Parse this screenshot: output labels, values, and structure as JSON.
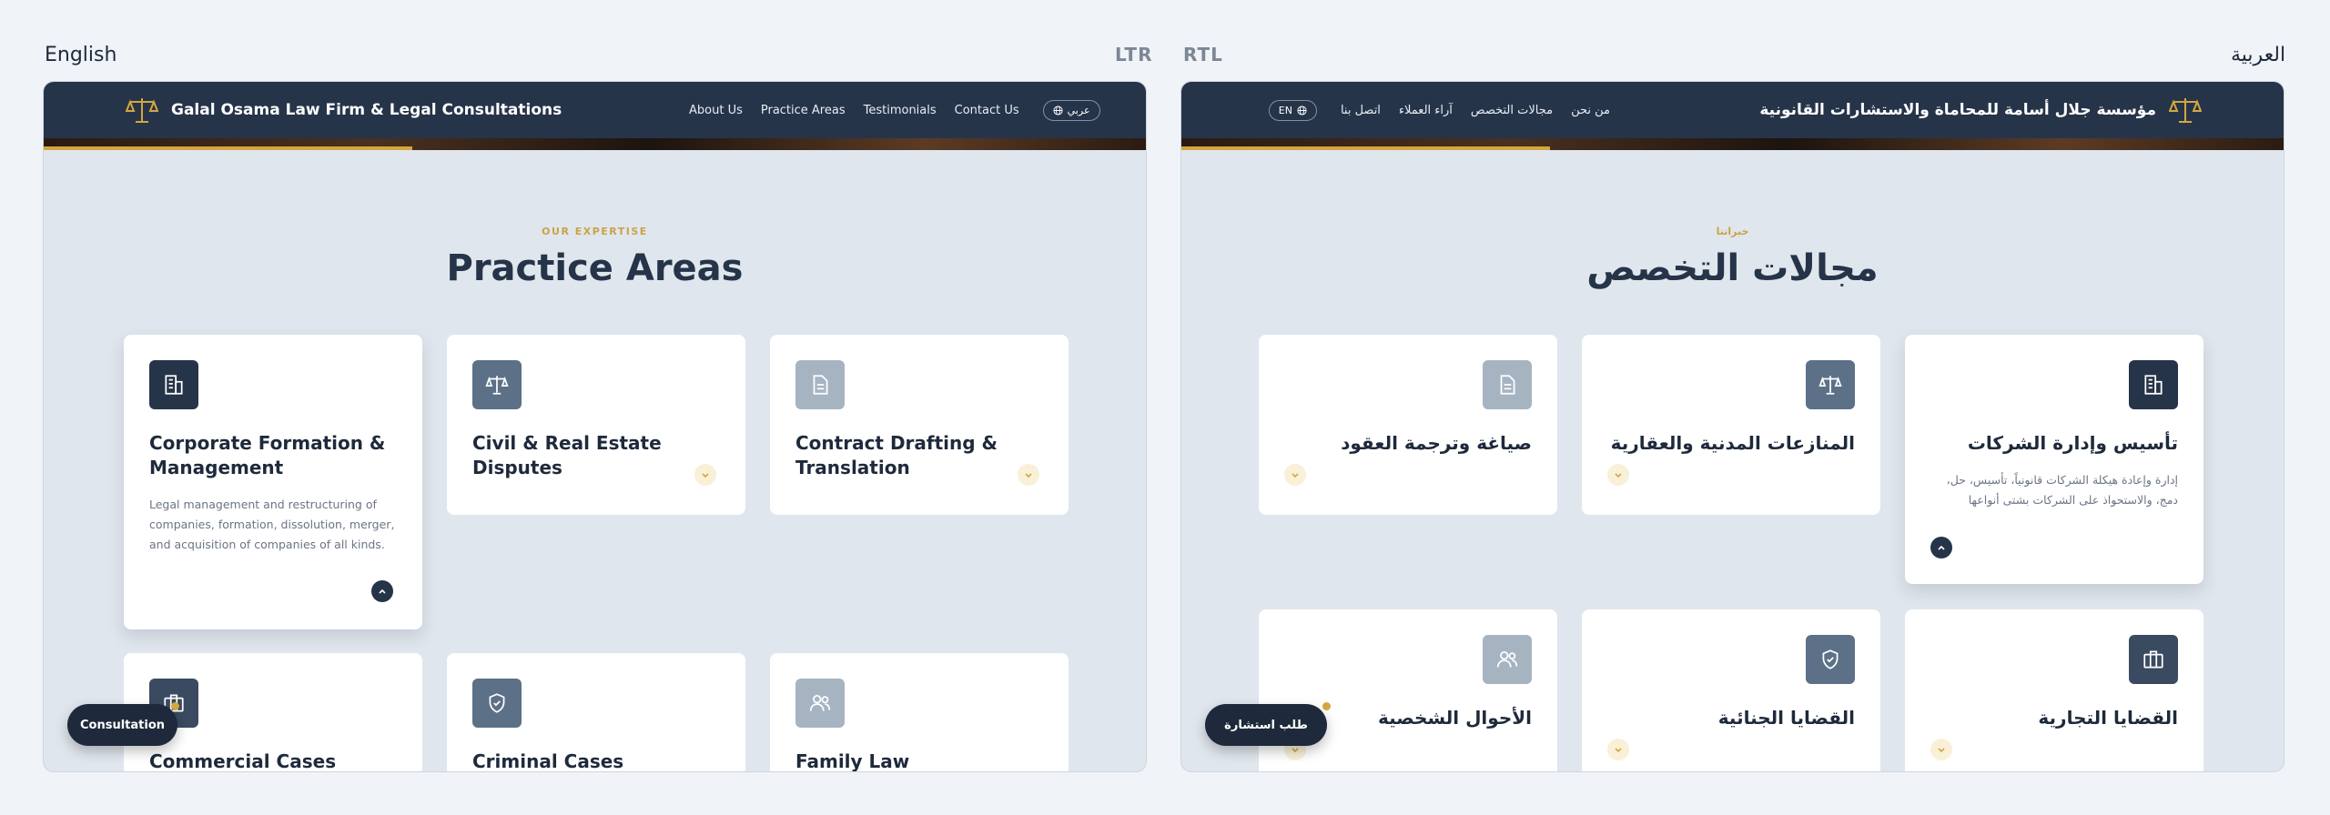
{
  "labels": {
    "left_lang": "English",
    "left_dir": "LTR",
    "right_dir": "RTL",
    "right_lang": "العربية"
  },
  "en": {
    "brand": "Galal Osama Law Firm & Legal Consultations",
    "nav": [
      "About Us",
      "Practice Areas",
      "Testimonials",
      "Contact Us"
    ],
    "lang_toggle": "عربي",
    "eyebrow": "OUR EXPERTISE",
    "title": "Practice Areas",
    "cards": [
      {
        "title": "Corporate Formation & Management",
        "desc": "Legal management and restructuring of companies, formation, dissolution, merger, and acquisition of companies of all kinds.",
        "icon": "building-icon",
        "color": "#263449"
      },
      {
        "title": "Civil & Real Estate Disputes",
        "icon": "scales-icon",
        "color": "#5c7087"
      },
      {
        "title": "Contract Drafting & Translation",
        "icon": "document-icon",
        "color": "#a6b4c2"
      },
      {
        "title": "Commercial Cases",
        "icon": "briefcase-icon",
        "color": "#3a4a60"
      },
      {
        "title": "Criminal Cases",
        "icon": "shield-icon",
        "color": "#5c7087"
      },
      {
        "title": "Family Law",
        "icon": "users-icon",
        "color": "#a6b4c2"
      }
    ],
    "fab": "Consultation"
  },
  "ar": {
    "brand": "مؤسسة جلال أسامة للمحاماة والاستشارات القانونية",
    "nav": [
      "من نحن",
      "مجالات التخصص",
      "آراء العملاء",
      "اتصل بنا"
    ],
    "lang_toggle": "EN",
    "eyebrow": "خبراتنا",
    "title": "مجالات التخصص",
    "cards": [
      {
        "title": "تأسيس وإدارة الشركات",
        "desc": "إدارة وإعادة هيكلة الشركات قانونياً، تأسيس، حل، دمج، والاستحواذ على الشركات بشتى أنواعها",
        "icon": "building-icon",
        "color": "#263449"
      },
      {
        "title": "المنازعات المدنية والعقارية",
        "icon": "scales-icon",
        "color": "#5c7087"
      },
      {
        "title": "صياغة وترجمة العقود",
        "icon": "document-icon",
        "color": "#a6b4c2"
      },
      {
        "title": "القضايا التجارية",
        "icon": "briefcase-icon",
        "color": "#3a4a60"
      },
      {
        "title": "القضايا الجنائية",
        "icon": "shield-icon",
        "color": "#5c7087"
      },
      {
        "title": "الأحوال الشخصية",
        "icon": "users-icon",
        "color": "#a6b4c2"
      }
    ],
    "fab": "طلب استشارة"
  },
  "colors": {
    "navy": "#263449",
    "gold": "#d4a640",
    "bg": "#e0e6ed"
  }
}
